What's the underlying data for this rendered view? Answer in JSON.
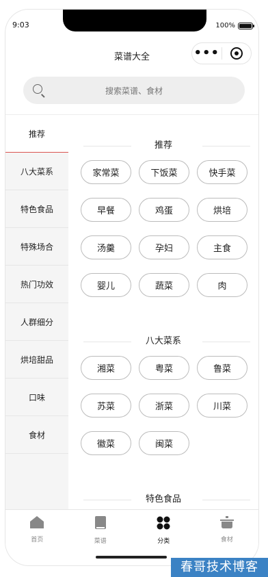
{
  "status_bar": {
    "time": "9:03",
    "battery": "100%"
  },
  "nav": {
    "title": "菜谱大全",
    "menu_icon": "more-dots-icon",
    "close_icon": "target-circle-icon"
  },
  "search": {
    "placeholder": "搜索菜谱、食材",
    "icon": "search-icon"
  },
  "sidebar": {
    "items": [
      "推荐",
      "八大菜系",
      "特色食品",
      "特殊场合",
      "热门功效",
      "人群细分",
      "烘培甜品",
      "口味",
      "食材"
    ],
    "active": "推荐",
    "active_color": "#d9534f"
  },
  "sections": [
    {
      "title": "推荐",
      "tags": [
        "家常菜",
        "下饭菜",
        "快手菜",
        "早餐",
        "鸡蛋",
        "烘培",
        "汤羹",
        "孕妇",
        "主食",
        "婴儿",
        "蔬菜",
        "肉"
      ]
    },
    {
      "title": "八大菜系",
      "tags": [
        "湘菜",
        "粤菜",
        "鲁菜",
        "苏菜",
        "浙菜",
        "川菜",
        "徽菜",
        "闽菜"
      ]
    },
    {
      "title": "特色食品",
      "tags": []
    }
  ],
  "tabbar": {
    "tabs": [
      {
        "label": "首页",
        "icon": "home-icon"
      },
      {
        "label": "菜谱",
        "icon": "book-icon"
      },
      {
        "label": "分类",
        "icon": "category-icon"
      },
      {
        "label": "食材",
        "icon": "pot-icon"
      }
    ],
    "active": "分类"
  },
  "watermark": "春哥技术博客"
}
